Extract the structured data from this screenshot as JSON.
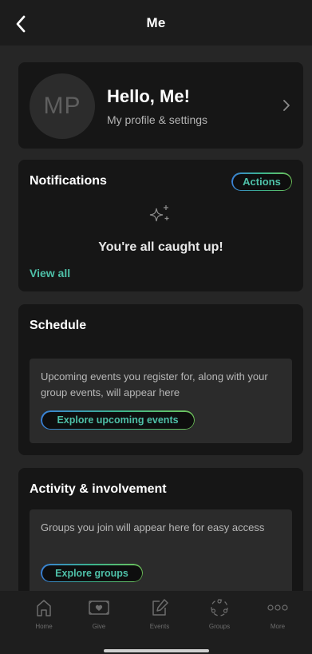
{
  "header": {
    "title": "Me",
    "back_icon": "chevron-left-icon"
  },
  "profile": {
    "initials": "MP",
    "greeting": "Hello, Me!",
    "subtitle": "My profile & settings",
    "chevron_icon": "chevron-right-icon"
  },
  "notifications": {
    "title": "Notifications",
    "actions_label": "Actions",
    "empty_icon": "sparkle-icon",
    "empty_message": "You're all caught up!",
    "view_all_label": "View all"
  },
  "schedule": {
    "title": "Schedule",
    "empty_message": "Upcoming events you register for, along with your group events, will appear here",
    "explore_label": "Explore upcoming events"
  },
  "activity": {
    "title": "Activity & involvement",
    "empty_message": "Groups you join will appear here for easy access",
    "explore_label": "Explore groups"
  },
  "tabbar": {
    "items": [
      {
        "label": "Home",
        "icon": "home-icon"
      },
      {
        "label": "Give",
        "icon": "give-icon"
      },
      {
        "label": "Events",
        "icon": "events-icon"
      },
      {
        "label": "Groups",
        "icon": "groups-icon"
      },
      {
        "label": "More",
        "icon": "more-icon"
      }
    ]
  },
  "colors": {
    "background": "#262626",
    "card": "#161616",
    "accent": "#4ec0a8",
    "gradient_start": "#3a7fd5",
    "gradient_end": "#6fc25a"
  }
}
